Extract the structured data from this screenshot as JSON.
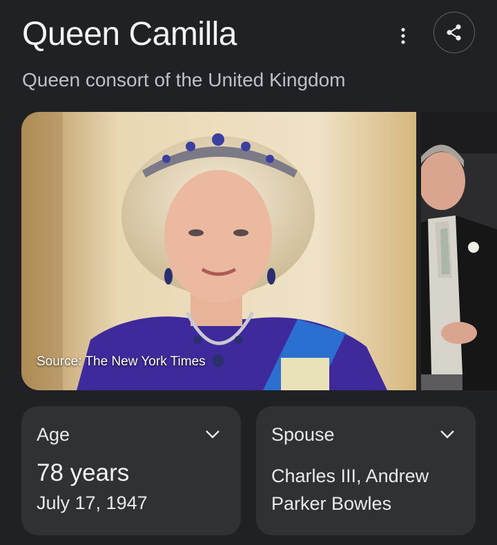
{
  "header": {
    "title": "Queen Camilla",
    "subtitle": "Queen consort of the United Kingdom",
    "more_icon": "more-vert-icon",
    "share_icon": "share-icon"
  },
  "images": {
    "main_source": "Source: The New York Times"
  },
  "facts": {
    "age": {
      "label": "Age",
      "value": "78 years",
      "detail": "July 17, 1947",
      "icon": "chevron-down-icon"
    },
    "spouse": {
      "label": "Spouse",
      "value": "Charles III, Andrew Parker Bowles",
      "icon": "chevron-down-icon"
    }
  },
  "colors": {
    "background": "#202124",
    "card": "#303134",
    "text_primary": "#e8eaed",
    "text_secondary": "#bdc1c6"
  }
}
